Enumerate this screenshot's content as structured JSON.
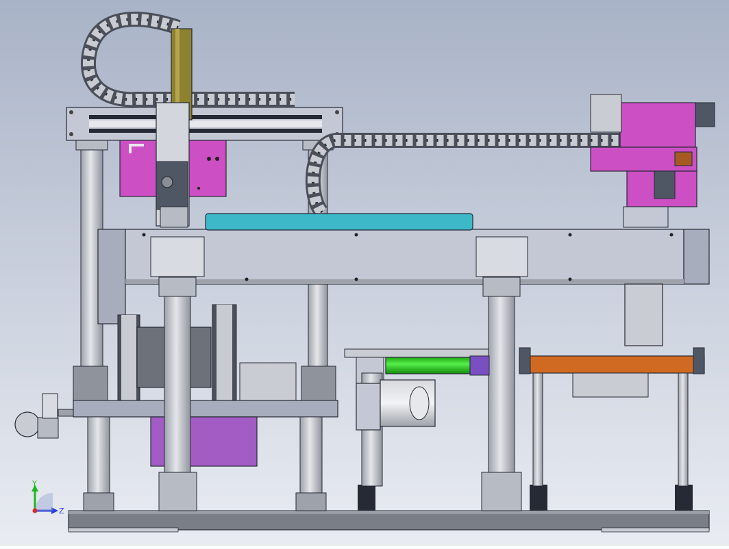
{
  "viewport": {
    "background_top": "#a9b3c7",
    "background_bottom": "#e9ecf2"
  },
  "colors": {
    "frame_gray": "#a7adbd",
    "frame_light": "#c3c8d4",
    "column_gray": "#c9ccd2",
    "dark_steel": "#4f5664",
    "base_plate": "#747880",
    "magenta_bracket": "#cc4fc4",
    "cyan_belt": "#3db8c9",
    "olive_cylinder": "#8d8030",
    "green_cylinder": "#27d618",
    "orange_plate": "#d06a22",
    "purple_plate": "#a35cc4",
    "outline": "#262a34"
  },
  "components": [
    "cable-chain-top",
    "gantry-x-beam",
    "vertical-z-axis",
    "magenta-motor-bracket",
    "cable-chain-long",
    "pneumatic-valve-block",
    "main-frame-beam",
    "cyan-conveyor-belt",
    "vertical-cable-chains",
    "lower-motor-block",
    "linear-slide",
    "green-cylinder-unit",
    "servo-motor",
    "orange-fixture-plate",
    "purple-mount-plate",
    "pressure-regulator",
    "support-columns",
    "leveling-feet",
    "base-plate"
  ],
  "triad": {
    "y_label": "Y",
    "z_label": "Z",
    "y_color": "#1db81d",
    "z_color": "#2a3fd8"
  }
}
